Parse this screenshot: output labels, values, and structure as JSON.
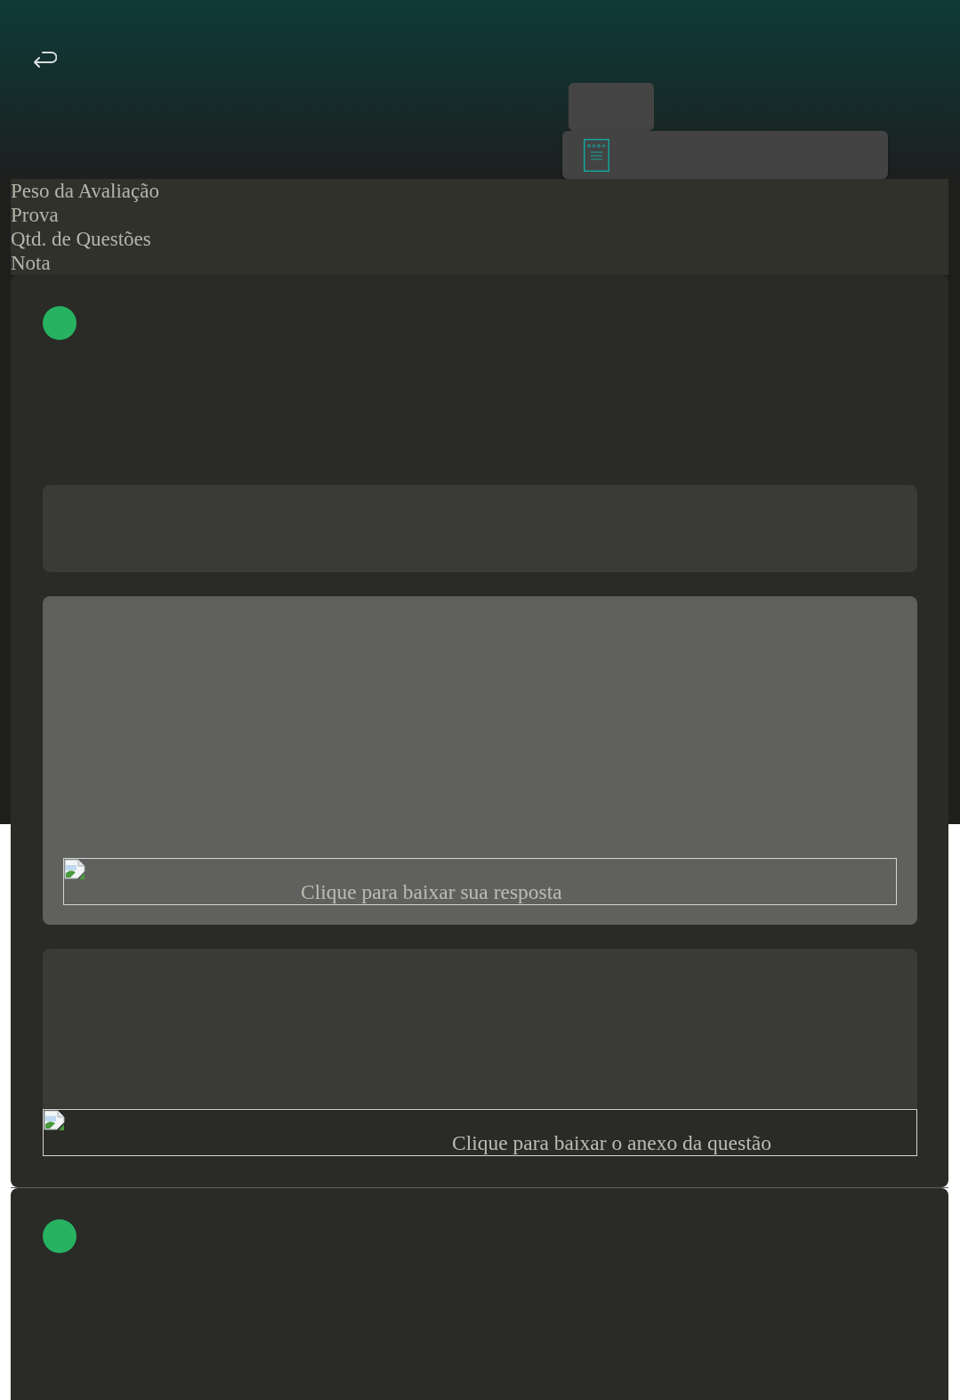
{
  "summary": {
    "labels": [
      "Peso da Avaliação",
      "Prova",
      "Qtd. de Questões",
      "Nota"
    ]
  },
  "questions": [
    {
      "color": "#27b262",
      "answer_link": "Clique para baixar sua resposta",
      "attachment_link": "Clique para baixar o anexo da questão"
    },
    {
      "color": "#27b262"
    }
  ]
}
